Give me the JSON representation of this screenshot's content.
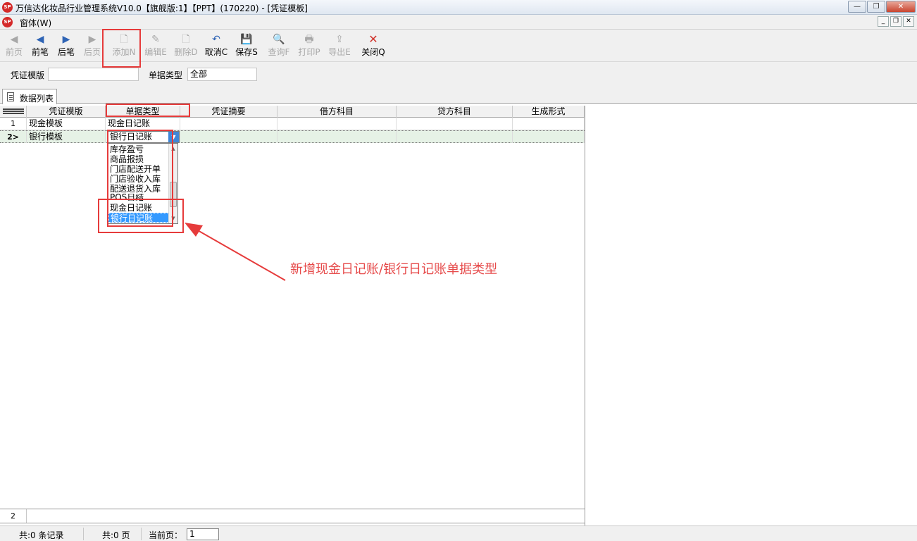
{
  "window": {
    "logo_text": "SP",
    "title": "万信达化妆品行业管理系统V10.0【旗舰版:1】【PPT】(170220) - [凭证模板]",
    "minimize": "—",
    "restore": "❐",
    "close": "✕"
  },
  "menu": {
    "window_label": "窗体(W)",
    "mdi_minimize": "_",
    "mdi_restore": "❐",
    "mdi_close": "✕"
  },
  "toolbar": {
    "first": {
      "label": "前页",
      "icon": "double-left-arrow",
      "glyph": "◀"
    },
    "prev": {
      "label": "前笔",
      "icon": "left-arrow",
      "glyph": "◀"
    },
    "next": {
      "label": "后笔",
      "icon": "right-arrow",
      "glyph": "▶"
    },
    "last": {
      "label": "后页",
      "icon": "double-right-arrow",
      "glyph": "▶"
    },
    "add": {
      "label": "添加N",
      "icon": "add-document",
      "glyph": "🗋"
    },
    "edit": {
      "label": "编辑E",
      "icon": "edit-document",
      "glyph": "✎"
    },
    "delete": {
      "label": "删除D",
      "icon": "delete-document",
      "glyph": "🗋"
    },
    "cancel": {
      "label": "取消C",
      "icon": "undo",
      "glyph": "↶"
    },
    "save": {
      "label": "保存S",
      "icon": "floppy-disk",
      "glyph": "💾"
    },
    "query": {
      "label": "查询F",
      "icon": "magnifier-document",
      "glyph": "🔍"
    },
    "print": {
      "label": "打印P",
      "icon": "printer",
      "glyph": "🖶"
    },
    "export": {
      "label": "导出E",
      "icon": "export",
      "glyph": "⇪"
    },
    "close": {
      "label": "关闭Q",
      "icon": "red-x",
      "glyph": "✕"
    }
  },
  "filter": {
    "template_label": "凭证模版",
    "template_value": "",
    "doc_type_label": "单据类型",
    "doc_type_value": "全部"
  },
  "tabs": {
    "data_list": "数据列表"
  },
  "grid": {
    "columns": [
      "凭证模版",
      "单据类型",
      "凭证摘要",
      "借方科目",
      "贷方科目",
      "生成形式"
    ],
    "rows": [
      {
        "no": "1",
        "template": "现金模板",
        "doc_type": "现金日记账",
        "summary": "",
        "debit": "",
        "credit": "",
        "form": ""
      },
      {
        "no": "2>",
        "template": "银行模板",
        "doc_type": "银行日记账",
        "summary": "",
        "debit": "",
        "credit": "",
        "form": ""
      }
    ],
    "footer_count": "2"
  },
  "dropdown": {
    "current": "银行日记账",
    "arrow_glyph": "▼",
    "options": [
      "库存盈亏",
      "商品报损",
      "门店配送开单",
      "门店验收入库",
      "配送退货入库",
      "POS日结",
      "现金日记账",
      "银行日记账"
    ],
    "selected_index": 7,
    "scroll_up_glyph": "▲",
    "scroll_down_glyph": "▼"
  },
  "annotation": {
    "text": "新增现金日记账/银行日记账单据类型",
    "color": "#e64a4a"
  },
  "status": {
    "records": "共:0 条记录",
    "pages": "共:0 页",
    "current_page_label": "当前页：",
    "current_page_value": "1"
  },
  "colors": {
    "highlight_box": "#e63b3b",
    "selected_option": "#3399ff",
    "selected_row": "#e6f2e6"
  }
}
